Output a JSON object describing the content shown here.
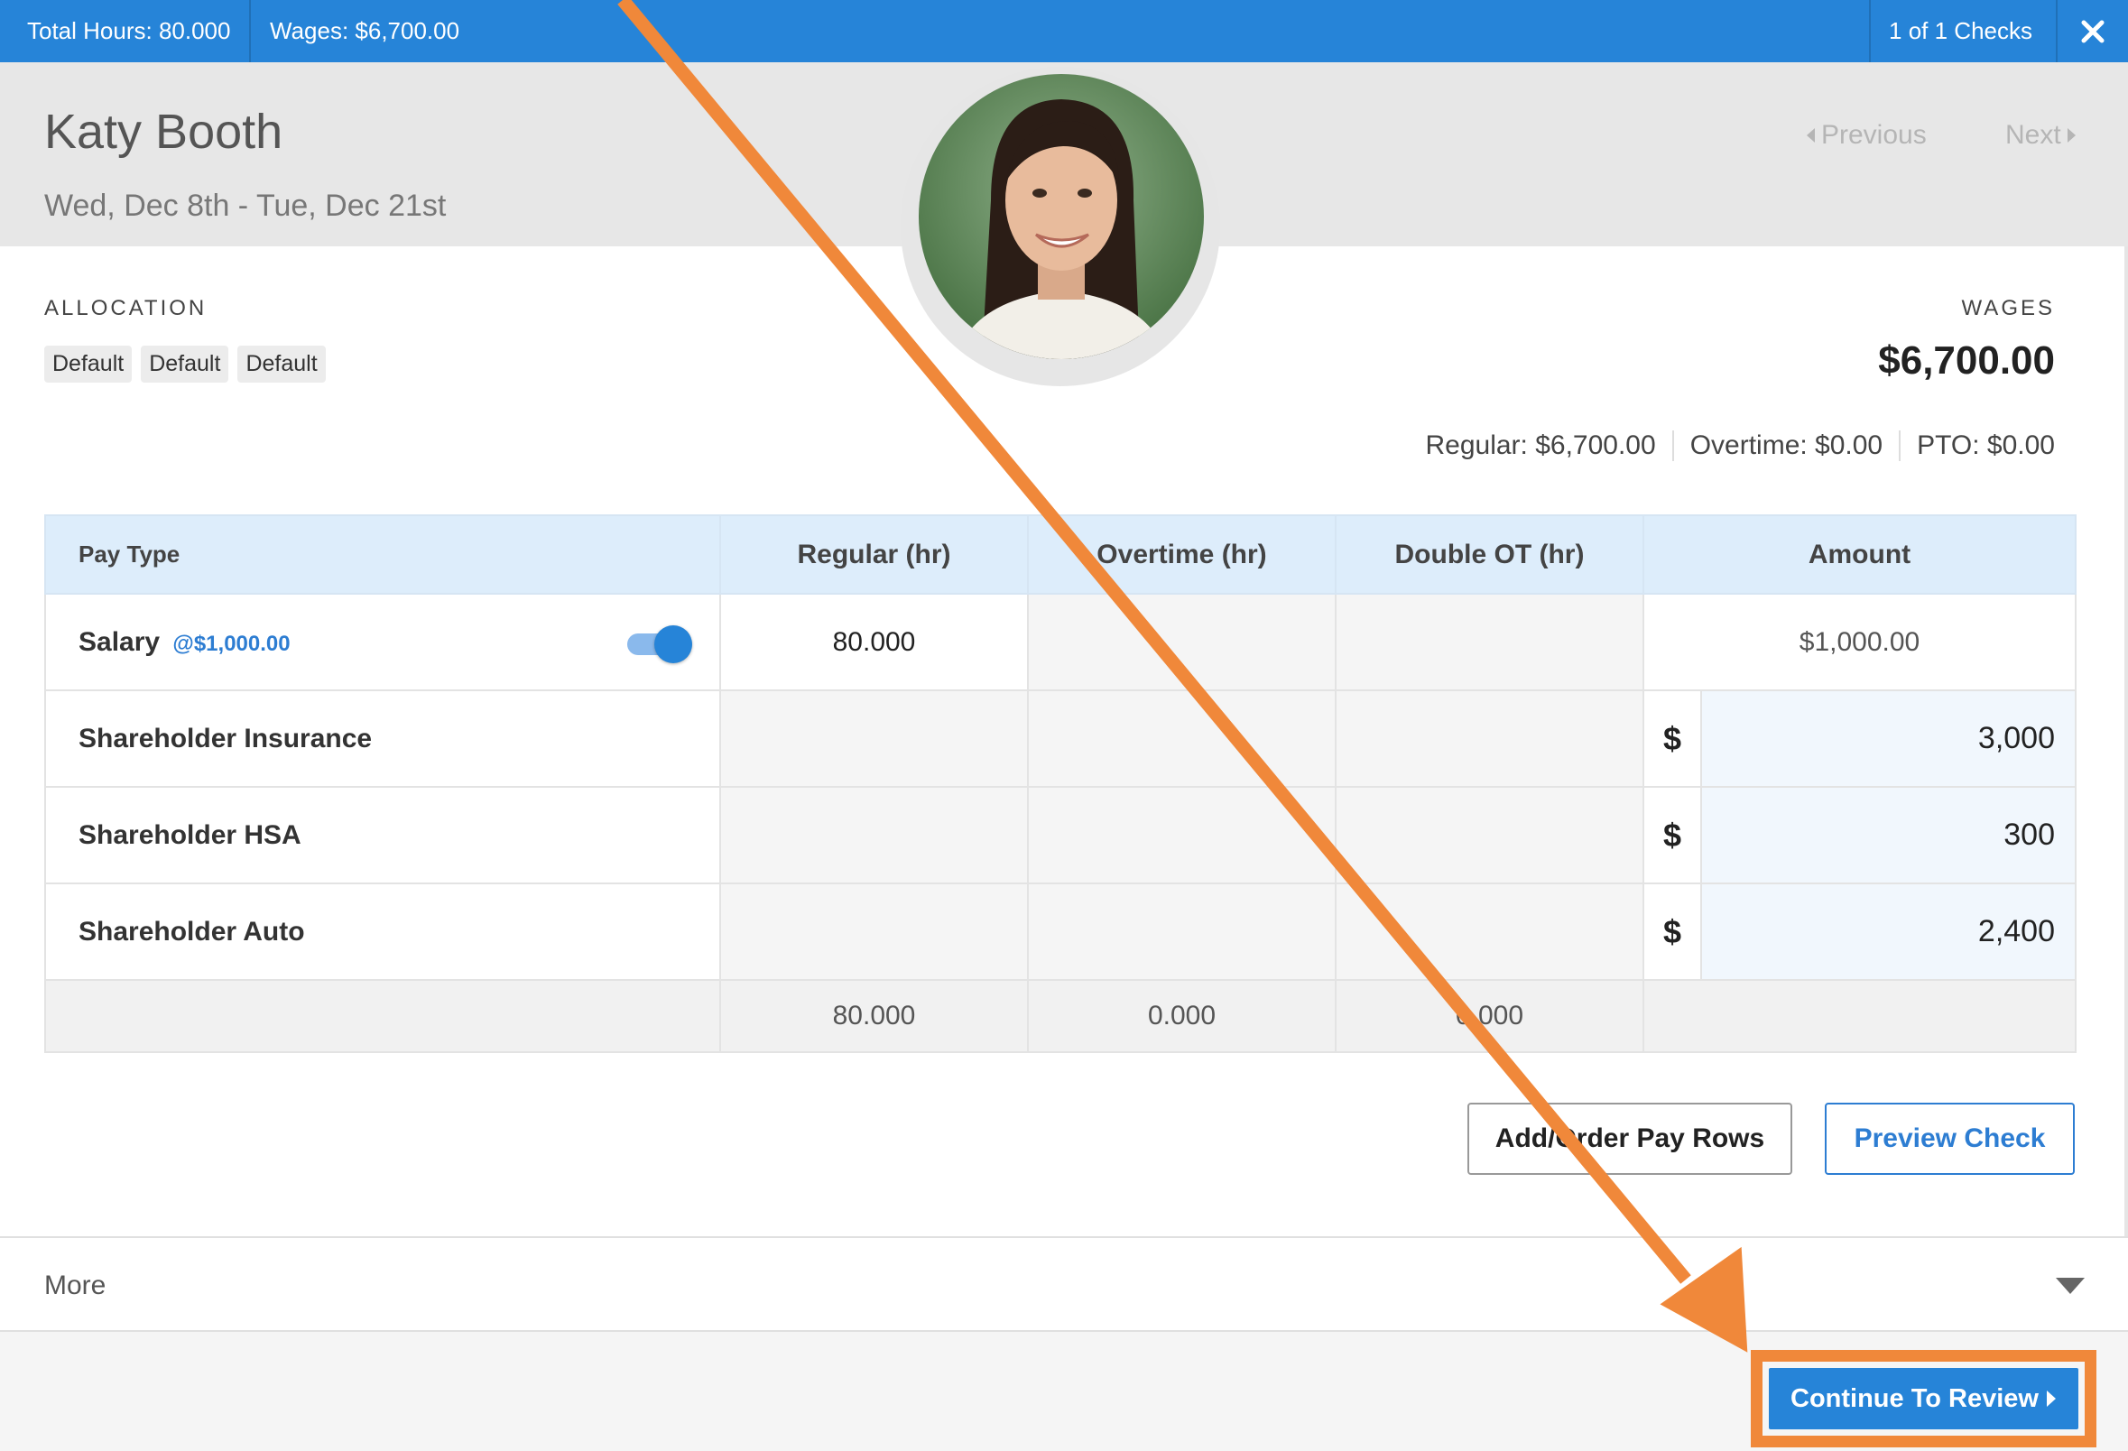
{
  "topbar": {
    "total_hours": "Total Hours: 80.000",
    "wages": "Wages: $6,700.00",
    "checks": "1 of 1 Checks"
  },
  "employee": {
    "name": "Katy Booth",
    "date_range": "Wed, Dec 8th - Tue, Dec 21st"
  },
  "nav": {
    "previous": "Previous",
    "next": "Next"
  },
  "allocation": {
    "label": "ALLOCATION",
    "chips": [
      "Default",
      "Default",
      "Default"
    ]
  },
  "wages": {
    "label": "WAGES",
    "total": "$6,700.00",
    "regular": "Regular: $6,700.00",
    "overtime": "Overtime: $0.00",
    "pto": "PTO: $0.00"
  },
  "table": {
    "headers": {
      "pay_type": "Pay Type",
      "regular": "Regular (hr)",
      "overtime": "Overtime (hr)",
      "double_ot": "Double OT (hr)",
      "amount": "Amount"
    },
    "salary": {
      "name": "Salary",
      "rate": "@$1,000.00",
      "regular": "80.000",
      "amount": "$1,000.00",
      "toggle_on": true
    },
    "rows": [
      {
        "name": "Shareholder Insurance",
        "currency": "$",
        "amount": "3,000"
      },
      {
        "name": "Shareholder HSA",
        "currency": "$",
        "amount": "300"
      },
      {
        "name": "Shareholder Auto",
        "currency": "$",
        "amount": "2,400"
      }
    ],
    "totals": {
      "regular": "80.000",
      "overtime": "0.000",
      "double_ot": "0.000"
    }
  },
  "buttons": {
    "add_order": "Add/Order Pay Rows",
    "preview": "Preview Check",
    "continue": "Continue To Review"
  },
  "more": {
    "label": "More"
  },
  "colors": {
    "accent": "#2684d8",
    "annotation": "#f0883a"
  },
  "icons": [
    "close-icon",
    "chevron-left-icon",
    "chevron-right-icon",
    "caret-down-icon",
    "annotation-arrow"
  ]
}
